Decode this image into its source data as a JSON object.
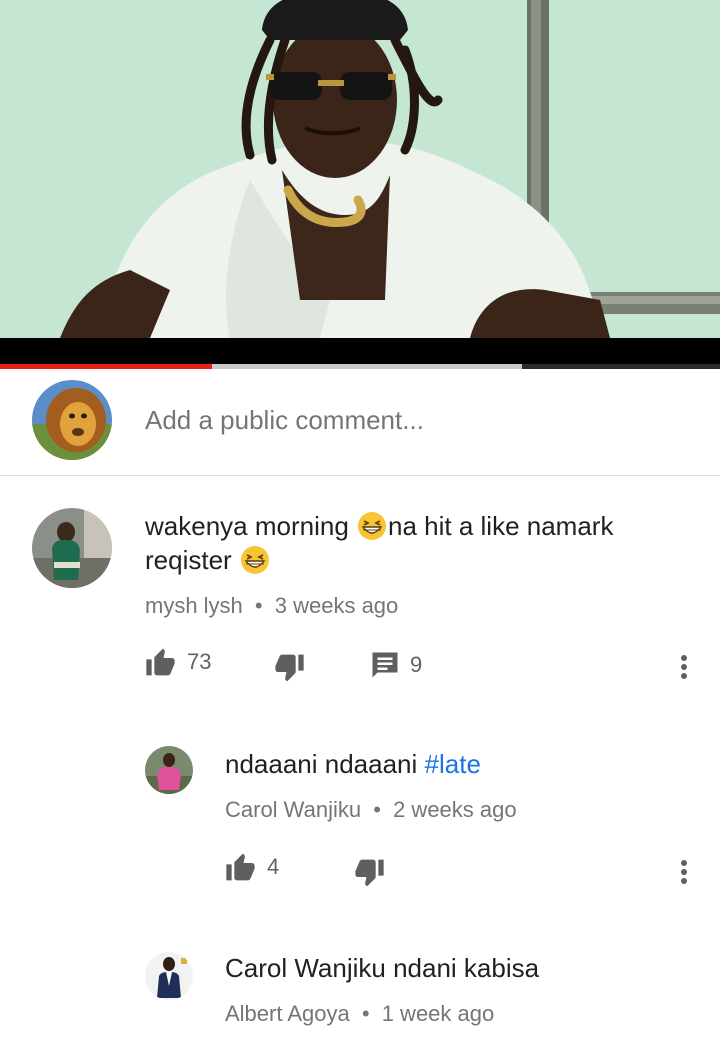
{
  "video": {
    "progress_played": 0.294,
    "progress_buffered": 0.725,
    "colors": {
      "played": "#e62117",
      "buffered": "#c9c9c9",
      "track": "#2b2b2b"
    }
  },
  "add_comment": {
    "placeholder": "Add a public comment..."
  },
  "comments": [
    {
      "text_before_emoji": "wakenya morning ",
      "text_middle": "na hit a like namark",
      "text_line2": "reqister",
      "emoji": "grinning-squinting-face",
      "author": "mysh lysh",
      "separator": "•",
      "time": "3 weeks ago",
      "likes": "73",
      "replies": "9"
    }
  ],
  "replies": [
    {
      "text": "ndaaani ndaaani ",
      "hashtag": "#late",
      "author": "Carol Wanjiku",
      "separator": "•",
      "time": "2 weeks ago",
      "likes": "4"
    },
    {
      "text": "Carol Wanjiku ndani kabisa",
      "author": "Albert Agoya",
      "separator": "•",
      "time": "1 week ago"
    }
  ],
  "icons": {
    "like": "thumb-up-icon",
    "dislike": "thumb-down-icon",
    "reply": "comment-icon",
    "more": "more-vert-icon"
  },
  "colors": {
    "accent_red": "#e62117",
    "link_blue": "#1a73e8",
    "meta_gray": "#757575",
    "icon_gray": "#616161"
  }
}
